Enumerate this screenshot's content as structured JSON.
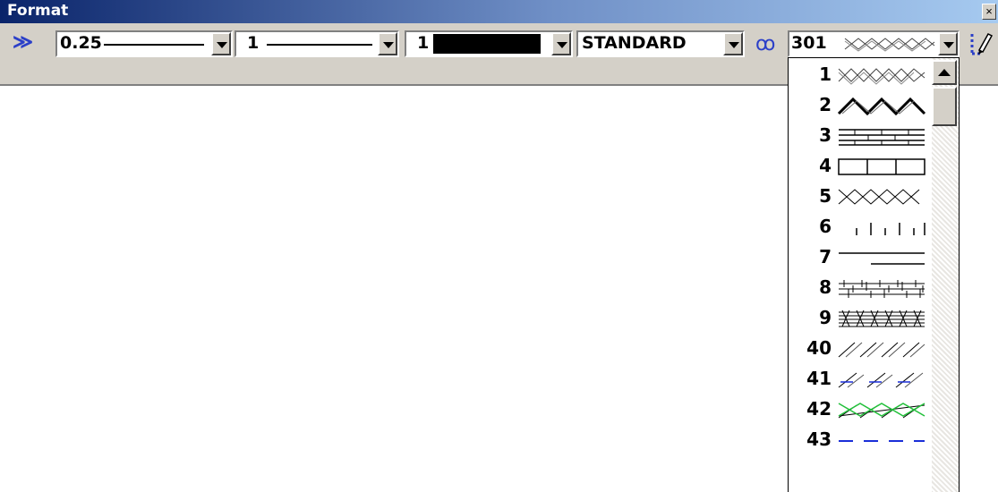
{
  "window": {
    "title": "Format",
    "close_glyph": "×"
  },
  "toolbar": {
    "more_glyph": "≫",
    "line_weight": {
      "value": "0.25",
      "icon": "solid-line"
    },
    "line_style": {
      "value": "1",
      "icon": "solid-line"
    },
    "color": {
      "value": "1",
      "swatch_color": "#000000"
    },
    "text_style": {
      "value": "STANDARD"
    },
    "bundle_glyph": "ꝏ",
    "hatch_pattern": {
      "value": "301",
      "icon": "zigzag-cross"
    },
    "pencil_icon": "pencil-icon"
  },
  "dropdown": {
    "items": [
      {
        "label": "1",
        "pattern": "cross-hatch"
      },
      {
        "label": "2",
        "pattern": "zigzag"
      },
      {
        "label": "3",
        "pattern": "brick"
      },
      {
        "label": "4",
        "pattern": "boxes"
      },
      {
        "label": "5",
        "pattern": "diamond-x"
      },
      {
        "label": "6",
        "pattern": "ticks"
      },
      {
        "label": "7",
        "pattern": "step-line"
      },
      {
        "label": "8",
        "pattern": "weave-fine"
      },
      {
        "label": "9",
        "pattern": "weave-dense"
      },
      {
        "label": "40",
        "pattern": "diagonals"
      },
      {
        "label": "41",
        "pattern": "diagonals-blue-ticks"
      },
      {
        "label": "42",
        "pattern": "diagonals-green-x"
      },
      {
        "label": "43",
        "pattern": "blue-dashes"
      }
    ]
  }
}
